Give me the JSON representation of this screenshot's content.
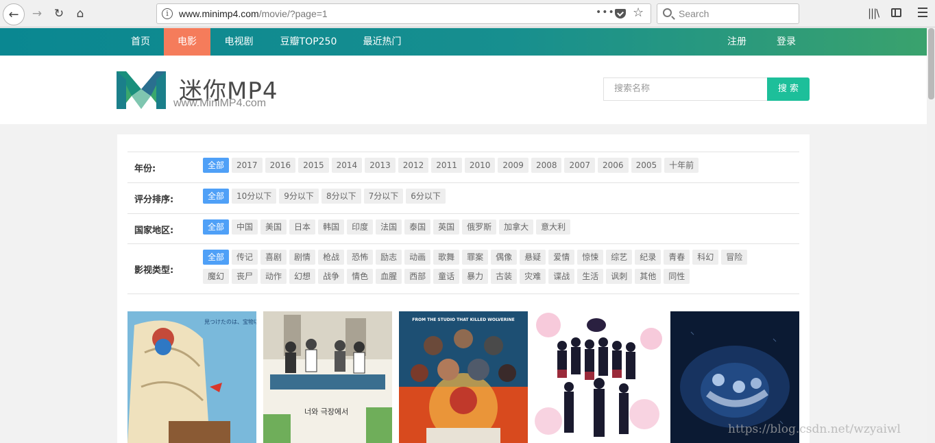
{
  "browser": {
    "url_host": "www.minimp4.com",
    "url_path": "/movie/?page=1",
    "url_dots": "•••",
    "search_placeholder": "Search"
  },
  "nav": {
    "items": [
      "首页",
      "电影",
      "电视剧",
      "豆瓣TOP250",
      "最近热门"
    ],
    "active_index": 1,
    "register": "注册",
    "login": "登录"
  },
  "header": {
    "logo_title": "迷你MP4",
    "logo_url": "www.MiniMP4.com",
    "search_placeholder": "搜索名称",
    "search_button": "搜 索"
  },
  "filters": {
    "year": {
      "label": "年份:",
      "options": [
        "全部",
        "2017",
        "2016",
        "2015",
        "2014",
        "2013",
        "2012",
        "2011",
        "2010",
        "2009",
        "2008",
        "2007",
        "2006",
        "2005",
        "十年前"
      ]
    },
    "rating": {
      "label": "评分排序:",
      "options": [
        "全部",
        "10分以下",
        "9分以下",
        "8分以下",
        "7分以下",
        "6分以下"
      ]
    },
    "country": {
      "label": "国家地区:",
      "options": [
        "全部",
        "中国",
        "美国",
        "日本",
        "韩国",
        "印度",
        "法国",
        "泰国",
        "英国",
        "俄罗斯",
        "加拿大",
        "意大利"
      ]
    },
    "genre": {
      "label": "影视类型:",
      "options": [
        "全部",
        "传记",
        "喜剧",
        "剧情",
        "枪战",
        "恐怖",
        "励志",
        "动画",
        "歌舞",
        "罪案",
        "偶像",
        "悬疑",
        "爱情",
        "惊悚",
        "综艺",
        "纪录",
        "青春",
        "科幻",
        "冒险",
        "魔幻",
        "丧尸",
        "动作",
        "幻想",
        "战争",
        "情色",
        "血腥",
        "西部",
        "童话",
        "暴力",
        "古装",
        "灾难",
        "谍战",
        "生活",
        "讽刺",
        "其他",
        "同性"
      ]
    }
  },
  "posters": [
    {
      "caption": "見つけたのは、宝物以上の、宝物。",
      "colors": [
        "#6fb3d6",
        "#e8d7b0",
        "#c44a3a"
      ]
    },
    {
      "caption": "너와 극장에서",
      "colors": [
        "#f2efe6",
        "#6fae5a",
        "#333333"
      ]
    },
    {
      "caption": "FROM THE STUDIO THAT KILLED WOLVERINE",
      "colors": [
        "#1d4f73",
        "#e2562a",
        "#f2b545"
      ]
    },
    {
      "caption": "",
      "colors": [
        "#ffffff",
        "#1a1a2e",
        "#f2a7c3"
      ]
    },
    {
      "caption": "",
      "colors": [
        "#0b1a33",
        "#2a5a9c",
        "#cfe3ff"
      ]
    }
  ],
  "watermark": "https://blog.csdn.net/wzyaiwl"
}
